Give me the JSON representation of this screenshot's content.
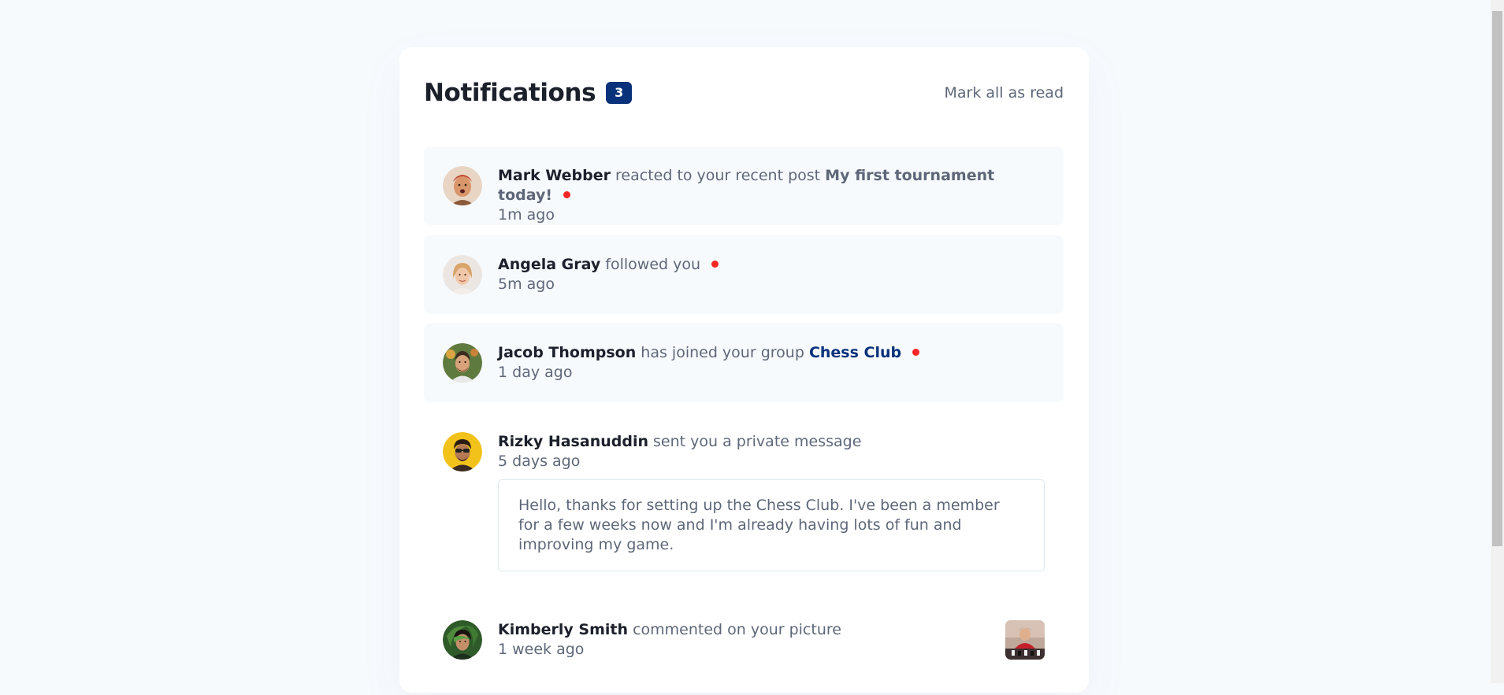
{
  "header": {
    "title": "Notifications",
    "unread_count": "3",
    "mark_all_label": "Mark all as read"
  },
  "notifications": [
    {
      "user": "Mark Webber",
      "action": "reacted to your recent post",
      "target": "My first tournament today!",
      "time": "1m ago",
      "unread": true,
      "avatar": "avatar-mark-webber"
    },
    {
      "user": "Angela Gray",
      "action": "followed you",
      "time": "5m ago",
      "unread": true,
      "avatar": "avatar-angela-gray"
    },
    {
      "user": "Jacob Thompson",
      "action": "has joined your group",
      "target": "Chess Club",
      "time": "1 day ago",
      "unread": true,
      "avatar": "avatar-jacob-thompson"
    },
    {
      "user": "Rizky Hasanuddin",
      "action": "sent you a private message",
      "time": "5 days ago",
      "unread": false,
      "avatar": "avatar-rizky-hasanuddin",
      "message": "Hello, thanks for setting up the Chess Club. I've been a member for a few weeks now and I'm already having lots of fun and improving my game."
    },
    {
      "user": "Kimberly Smith",
      "action": "commented on your picture",
      "time": "1 week ago",
      "unread": false,
      "avatar": "avatar-kimberly-smith",
      "picture": "chess-picture-thumbnail"
    }
  ],
  "colors": {
    "page_bg": "#f7fafd",
    "card_bg": "#ffffff",
    "badge_bg": "#0a327b",
    "dot": "#f62626",
    "heading": "#1c202b",
    "text": "#5e6778",
    "group_link": "#0a327b"
  }
}
